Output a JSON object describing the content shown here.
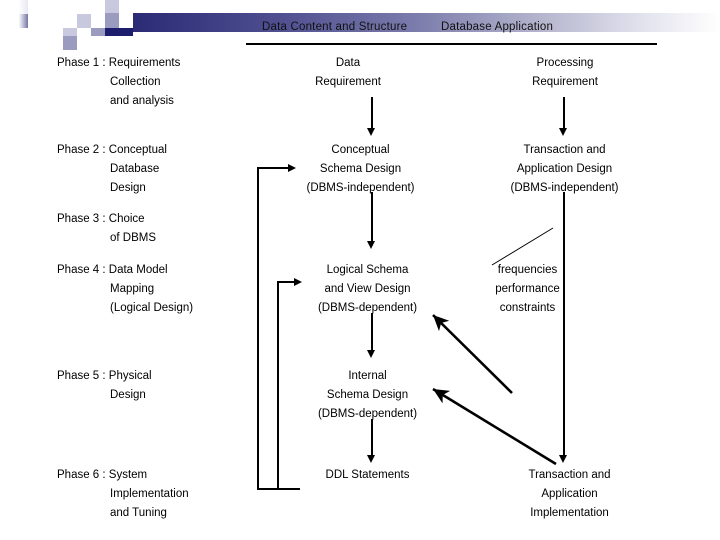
{
  "header": {
    "title_left": "Data Content and Structure",
    "title_right": "Database Application",
    "accent_dark": "#2b2b76",
    "accent_mid": "#9b9bc0",
    "accent_light": "#c8c8de",
    "rule_color": "#000000"
  },
  "phases": [
    {
      "id": "phase-1",
      "lines": [
        "Phase 1 : Requirements",
        "Collection",
        "and analysis"
      ]
    },
    {
      "id": "phase-2",
      "lines": [
        "Phase 2 : Conceptual",
        "Database",
        "Design"
      ]
    },
    {
      "id": "phase-3",
      "lines": [
        "Phase 3 : Choice",
        "of DBMS"
      ]
    },
    {
      "id": "phase-4",
      "lines": [
        "Phase 4 : Data Model",
        "Mapping",
        "(Logical Design)"
      ]
    },
    {
      "id": "phase-5",
      "lines": [
        "Phase 5 : Physical",
        "Design"
      ]
    },
    {
      "id": "phase-6",
      "lines": [
        "Phase 6 : System",
        "Implementation",
        "and Tuning"
      ]
    }
  ],
  "middle": [
    {
      "id": "data-requirement",
      "lines": [
        "Data",
        "Requirement"
      ]
    },
    {
      "id": "conceptual-schema-design",
      "lines": [
        "Conceptual",
        "Schema Design",
        "(DBMS-independent)"
      ]
    },
    {
      "id": "logical-schema-and-view-design",
      "lines": [
        "Logical Schema",
        "and View Design",
        "(DBMS-dependent)"
      ]
    },
    {
      "id": "internal-schema-design",
      "lines": [
        "Internal",
        "Schema Design",
        "(DBMS-dependent)"
      ]
    },
    {
      "id": "ddl-statements",
      "lines": [
        "DDL Statements"
      ]
    }
  ],
  "right": [
    {
      "id": "processing-requirement",
      "lines": [
        "Processing",
        "Requirement"
      ]
    },
    {
      "id": "transaction-and-application-design",
      "lines": [
        "Transaction and",
        "Application Design",
        "(DBMS-independent)"
      ]
    },
    {
      "id": "frequencies-performance-constraints",
      "lines": [
        "frequencies",
        "performance",
        "constraints"
      ]
    },
    {
      "id": "transaction-and-application-implementation",
      "lines": [
        "Transaction and",
        "Application",
        "Implementation"
      ]
    }
  ]
}
